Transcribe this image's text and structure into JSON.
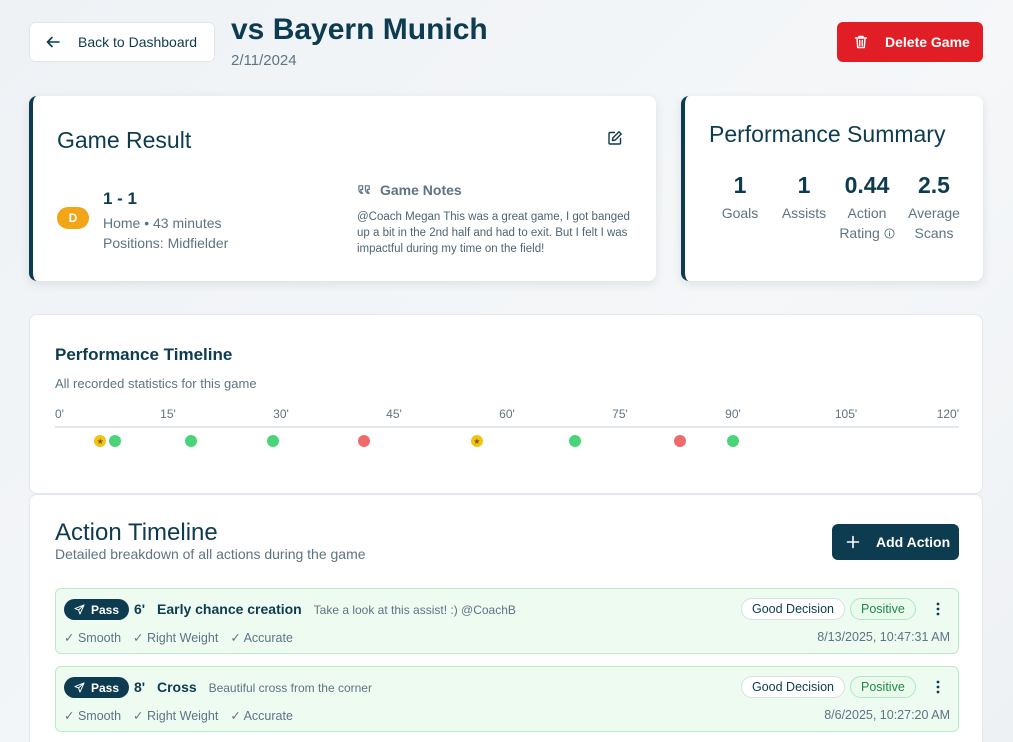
{
  "header": {
    "back_label": "Back to Dashboard",
    "title": "vs Bayern Munich",
    "date": "2/11/2024",
    "delete_label": "Delete Game"
  },
  "game_result": {
    "title": "Game Result",
    "result_badge": "D",
    "score": "1 - 1",
    "meta": "Home • 43 minutes",
    "positions": "Positions: Midfielder",
    "notes_title": "Game Notes",
    "notes_text": "@Coach Megan This was a great game, I got banged up a bit in the 2nd half and had to exit. But I felt I was impactful during my time on the field!"
  },
  "performance_summary": {
    "title": "Performance Summary",
    "stats": [
      {
        "value": "1",
        "label": "Goals"
      },
      {
        "value": "1",
        "label": "Assists"
      },
      {
        "value": "0.44",
        "label_line1": "Action",
        "label_line2": "Rating"
      },
      {
        "value": "2.5",
        "label_line1": "Average",
        "label_line2": "Scans"
      }
    ]
  },
  "performance_timeline": {
    "title": "Performance Timeline",
    "subtitle": "All recorded statistics for this game",
    "ticks": [
      "0'",
      "15'",
      "30'",
      "45'",
      "60'",
      "75'",
      "90'",
      "105'",
      "120'"
    ],
    "max_minute": 120,
    "events": [
      {
        "minute": 6,
        "kind": "star",
        "color": "#f2c214"
      },
      {
        "minute": 8,
        "kind": "positive",
        "color": "#4ad47a"
      },
      {
        "minute": 18,
        "kind": "positive",
        "color": "#4ad47a"
      },
      {
        "minute": 29,
        "kind": "positive",
        "color": "#4ad47a"
      },
      {
        "minute": 41,
        "kind": "negative",
        "color": "#ef6b6b"
      },
      {
        "minute": 56,
        "kind": "star",
        "color": "#f2c214"
      },
      {
        "minute": 69,
        "kind": "positive",
        "color": "#4ad47a"
      },
      {
        "minute": 83,
        "kind": "negative",
        "color": "#ef6b6b"
      },
      {
        "minute": 90,
        "kind": "positive",
        "color": "#4ad47a"
      }
    ]
  },
  "action_timeline": {
    "title": "Action Timeline",
    "subtitle": "Detailed breakdown of all actions during the game",
    "add_label": "Add Action",
    "rows": [
      {
        "type": "Pass",
        "minute": "6'",
        "title": "Early chance creation",
        "note": "Take a look at this assist! :) @CoachB",
        "qualities": [
          "✓ Smooth",
          "✓ Right Weight",
          "✓ Accurate"
        ],
        "decision": "Good Decision",
        "outcome": "Positive",
        "timestamp": "8/13/2025, 10:47:31 AM"
      },
      {
        "type": "Pass",
        "minute": "8'",
        "title": "Cross",
        "note": "Beautiful cross from the corner",
        "qualities": [
          "✓ Smooth",
          "✓ Right Weight",
          "✓ Accurate"
        ],
        "decision": "Good Decision",
        "outcome": "Positive",
        "timestamp": "8/6/2025, 10:27:20 AM"
      }
    ]
  },
  "colors": {
    "primary": "#0d3b4f",
    "danger": "#e11d26",
    "draw_badge": "#f2a516",
    "positive": "#4ad47a",
    "negative": "#ef6b6b"
  }
}
